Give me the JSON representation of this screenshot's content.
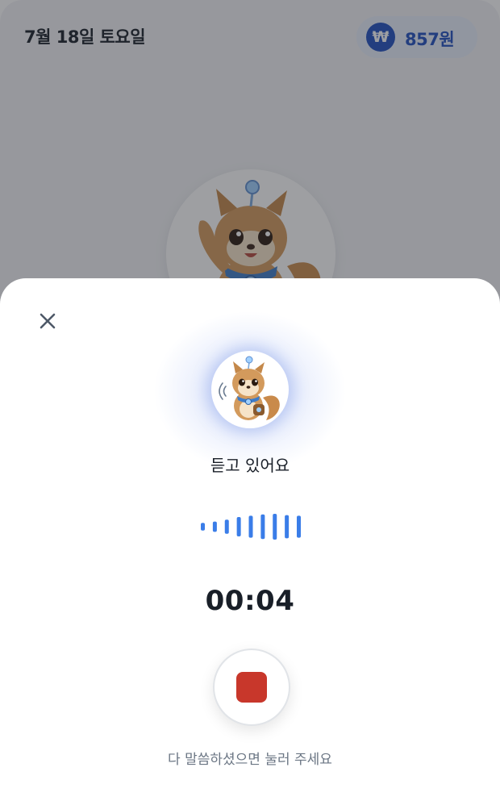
{
  "header": {
    "date": "7월 18일 토요일",
    "points_symbol": "₩",
    "points_amount": "857원"
  },
  "recorder": {
    "status": "듣고 있어요",
    "timer": "00:04",
    "hint": "다 말씀하셨으면 눌러 주세요",
    "wave_levels": [
      0.3,
      0.4,
      0.55,
      0.75,
      0.85,
      0.95,
      1.0,
      0.9,
      0.85
    ]
  },
  "icons": {
    "close": "close-icon",
    "won": "won-coin-icon",
    "mascot": "squirrel-mascot-icon",
    "stop": "stop-icon"
  },
  "colors": {
    "accent_blue": "#1f4fbf",
    "wave_blue": "#3a7de8",
    "stop_red": "#c8372b",
    "text_dark": "#191f28",
    "text_muted": "#6b7684"
  }
}
